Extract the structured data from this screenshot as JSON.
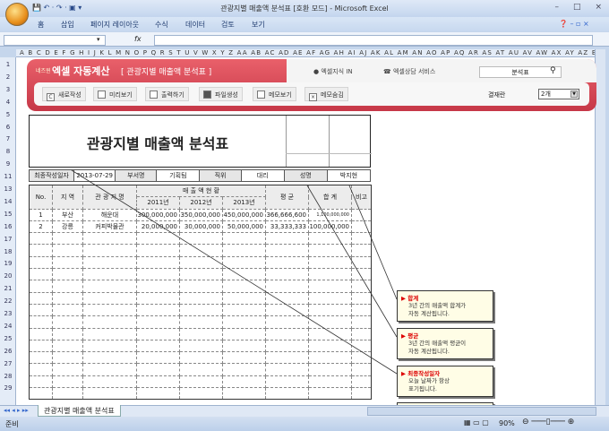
{
  "window": {
    "title": "관광지별 매출액 분석표 [호환 모드] - Microsoft Excel",
    "controls": [
      "–",
      "□",
      "×"
    ]
  },
  "ribbon": {
    "tabs": [
      "홈",
      "삽입",
      "페이지 레이아웃",
      "수식",
      "데이터",
      "검토",
      "보기"
    ]
  },
  "formula_bar": {
    "name_box": "",
    "fx": "fx",
    "value": ""
  },
  "columns": "A B C D E F G H I J K L M N O P Q R S T U V W X Y Z AA AB AC AD AE AF AG AH AI AJ AK AL AM AN AO AP AQ AR AS AT AU AV AW AX AY AZ BB BC",
  "rows": [
    "1",
    "2",
    "3",
    "4",
    "5",
    "6",
    "7",
    "8",
    "9",
    "11",
    "13",
    "14",
    "15",
    "16",
    "17",
    "18",
    "19",
    "20",
    "21",
    "22",
    "23",
    "24",
    "25",
    "26",
    "27",
    "28",
    "29"
  ],
  "banner": {
    "brand_small": "네즈윈",
    "brand": "엑셀 자동계산",
    "subtitle": "[ 관광지별 매출액 분석표 ]",
    "nav": [
      "엑셀지식 IN",
      "엑셀상담 서비스"
    ],
    "search_value": "분석표",
    "buttons": [
      "새로작성",
      "미리보기",
      "출력하기",
      "파일생성",
      "메모보기",
      "메모숨김"
    ],
    "display_label": "결재란",
    "display_value": "2개"
  },
  "doc": {
    "title": "관광지별 매출액 분석표",
    "info": {
      "date_label": "최종작성일자",
      "date": "2013-07-29",
      "dept_label": "부서명",
      "dept": "기획팀",
      "pos_label": "직위",
      "pos": "대리",
      "name_label": "성명",
      "name": "박지현"
    },
    "headers": {
      "no": "No.",
      "region": "지 역",
      "site": "관 광 지 명",
      "sales": "매 출 액 현 황",
      "y1": "2011년",
      "y2": "2012년",
      "y3": "2013년",
      "avg": "평 균",
      "total": "합 계",
      "note": "비고"
    },
    "rows": [
      {
        "no": "1",
        "region": "부산",
        "site": "해운대",
        "y1": "300,000,000",
        "y2": "350,000,000",
        "y3": "450,000,000",
        "avg": "366,666,600",
        "total": "1,100,000,000",
        "note": ""
      },
      {
        "no": "2",
        "region": "강릉",
        "site": "커피박물관",
        "y1": "20,000,000",
        "y2": "30,000,000",
        "y3": "50,000,000",
        "avg": "33,333,333",
        "total": "100,000,000",
        "note": ""
      }
    ]
  },
  "callouts": [
    {
      "title": "합계",
      "body": [
        "3년 간의 매출액 합계가",
        "자동 계산됩니다."
      ]
    },
    {
      "title": "평균",
      "body": [
        "3년 간의 매출액 평균이",
        "자동 계산됩니다."
      ]
    },
    {
      "title": "최종작성일자",
      "body": [
        "오늘 날짜가 항상",
        "표기됩니다."
      ]
    }
  ],
  "sheet_tab": "관광지별 매출액 분석표",
  "status": {
    "ready": "준비",
    "zoom": "90%"
  }
}
